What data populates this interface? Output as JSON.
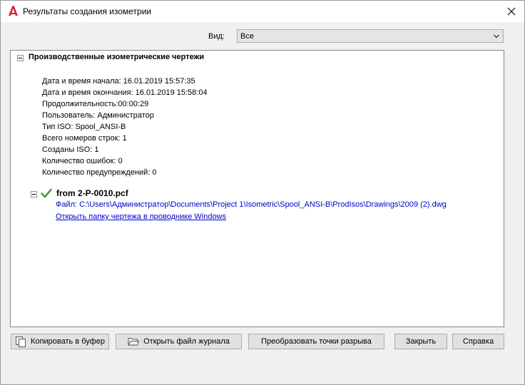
{
  "window": {
    "title": "Результаты создания изометрии",
    "logo_icon": "autocad-logo-icon",
    "close_icon": "close-icon"
  },
  "view": {
    "label": "Вид:",
    "selected": "Все"
  },
  "report": {
    "section_title": "Производственные изометрические чертежи",
    "details": [
      "Дата и время начала: 16.01.2019 15:57:35",
      "Дата и время окончания: 16.01.2019 15:58:04",
      "Продолжительность:00:00:29",
      "Пользователь: Администратор",
      "Тип ISO: Spool_ANSI-B",
      "Всего номеров строк: 1",
      "Созданы ISO: 1",
      "Количество ошибок: 0",
      "Количество предупреждений: 0"
    ],
    "file": {
      "title": "from 2-P-0010.pcf",
      "path": "Файл: C:\\Users\\Администратор\\Documents\\Project 1\\Isometric\\Spool_ANSI-B\\ProdIsos\\Drawings\\2009 (2).dwg",
      "open_link": "Открыть папку чертежа в проводнике Windows",
      "status_icon": "checkmark-icon"
    }
  },
  "buttons": {
    "copy": "Копировать в буфер",
    "open_log": "Открыть файл журнала",
    "convert": "Преобразовать точки разрыва",
    "close": "Закрыть",
    "help": "Справка"
  },
  "colors": {
    "link": "#0000cc",
    "check": "#3aa03a",
    "logo": "#d2232a"
  }
}
